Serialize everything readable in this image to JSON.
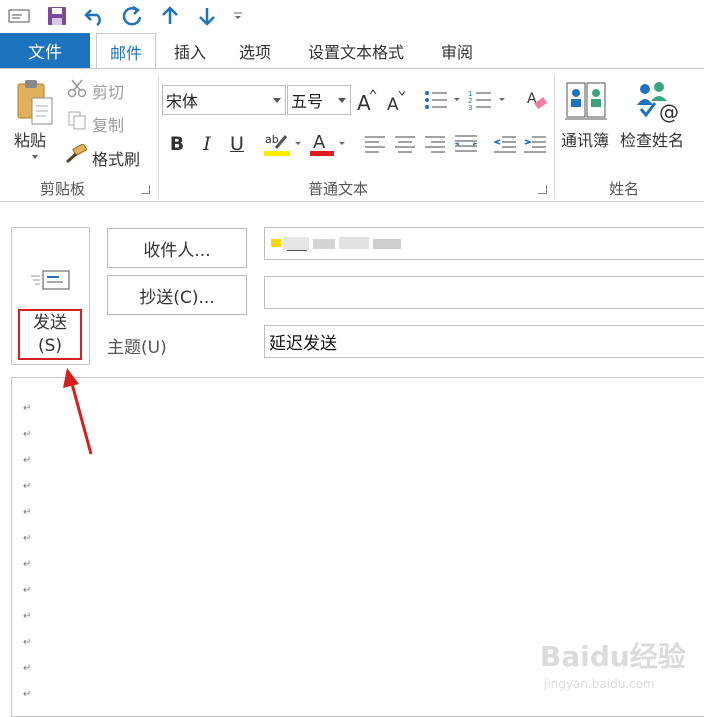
{
  "quick_access": {
    "icons": [
      "mail-icon",
      "save-icon",
      "undo-icon",
      "redo-icon",
      "up-arrow-icon",
      "down-arrow-icon",
      "customize-icon"
    ]
  },
  "tabs": {
    "file": "文件",
    "items": [
      "邮件",
      "插入",
      "选项",
      "设置文本格式",
      "审阅"
    ],
    "active": "邮件"
  },
  "ribbon": {
    "clipboard": {
      "paste": "粘贴",
      "cut": "剪切",
      "copy": "复制",
      "format_painter": "格式刷",
      "label": "剪贴板"
    },
    "basic_text": {
      "font": "宋体",
      "size": "五号",
      "label": "普通文本",
      "bold": "B",
      "italic": "I",
      "underline": "U",
      "highlight_color": "#ffeb00",
      "font_color": "#e21b1b"
    },
    "names": {
      "address_book": "通讯簿",
      "check_names": "检查姓名",
      "label": "姓名"
    }
  },
  "compose": {
    "send_line1": "发送",
    "send_line2": "(S)",
    "to_button": "收件人...",
    "cc_button": "抄送(C)...",
    "subject_label": "主题(U)",
    "to_value": "",
    "cc_value": "",
    "subject_value": "延迟发送",
    "paragraph_mark": "↵"
  },
  "watermark": {
    "brand": "Baidu经验",
    "url": "jingyan.baidu.com"
  },
  "colors": {
    "accent": "#1e73be",
    "annotation": "#d32020"
  }
}
